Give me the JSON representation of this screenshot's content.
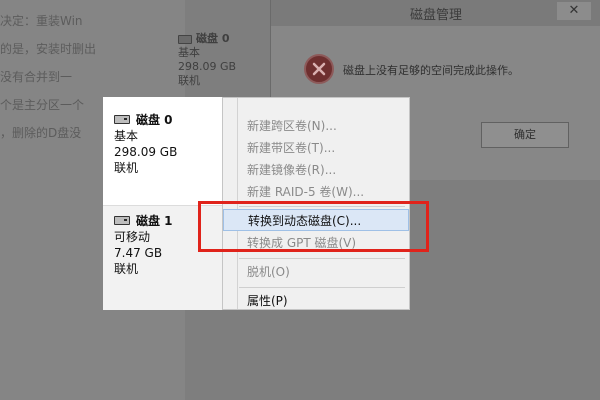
{
  "background_lines": [
    "决定：重装Win",
    "的是，安装时删出",
    "没有合并到一",
    "个是主分区一个",
    "，删除的D盘没"
  ],
  "bg_disk": {
    "name": "磁盘 0",
    "type": "基本",
    "size": "298.09 GB",
    "status": "联机"
  },
  "dialog": {
    "title": "磁盘管理",
    "close": "✕",
    "message": "磁盘上没有足够的空间完成此操作。",
    "ok_label": "确定",
    "icon": "error-icon"
  },
  "disks": [
    {
      "name": "磁盘 0",
      "type": "基本",
      "size": "298.09 GB",
      "status": "联机"
    },
    {
      "name": "磁盘 1",
      "type": "可移动",
      "size": "7.47 GB",
      "status": "联机"
    }
  ],
  "menu": {
    "items": [
      {
        "label": "新建跨区卷(N)...",
        "enabled": false
      },
      {
        "label": "新建带区卷(T)...",
        "enabled": false
      },
      {
        "label": "新建镜像卷(R)...",
        "enabled": false
      },
      {
        "label": "新建 RAID-5 卷(W)...",
        "enabled": false
      },
      {
        "label": "转换到动态磁盘(C)...",
        "enabled": true,
        "highlighted": true
      },
      {
        "label": "转换成 GPT 磁盘(V)",
        "enabled": false
      },
      {
        "label": "脱机(O)",
        "enabled": false
      },
      {
        "label": "属性(P)",
        "enabled": true
      }
    ]
  },
  "colors": {
    "highlight_border": "#e0231b",
    "menu_highlight": "#dbe7f6"
  }
}
